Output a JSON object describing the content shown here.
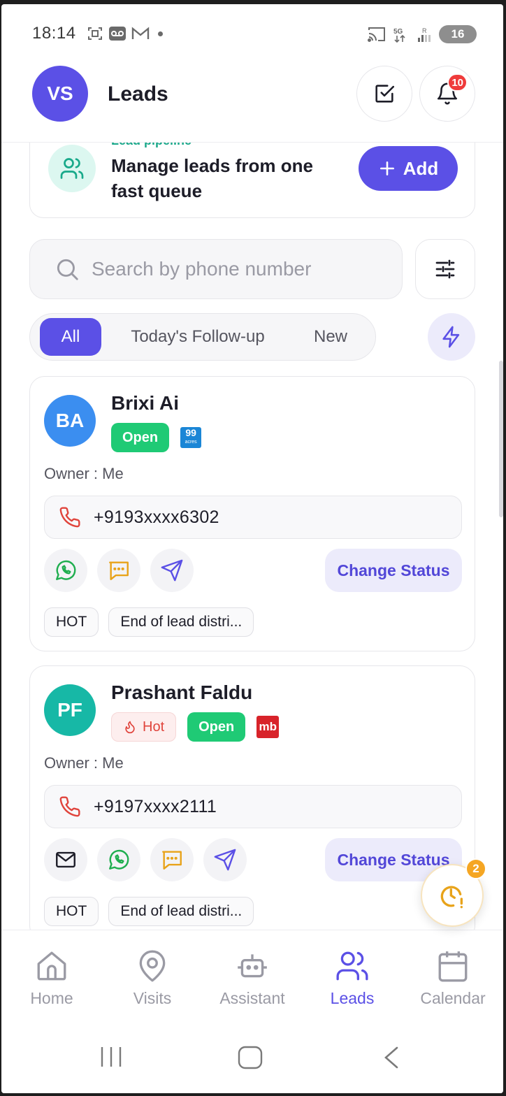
{
  "status_bar": {
    "time": "18:14",
    "battery": "16"
  },
  "header": {
    "avatar_initials": "VS",
    "title": "Leads",
    "notification_count": "10"
  },
  "pipeline": {
    "kicker": "Lead pipeline",
    "headline": "Manage leads from one fast queue",
    "add_label": "Add"
  },
  "search": {
    "placeholder": "Search by phone number",
    "value": ""
  },
  "tabs": [
    {
      "label": "All",
      "active": true
    },
    {
      "label": "Today's Follow-up",
      "active": false
    },
    {
      "label": "New",
      "active": false
    }
  ],
  "leads": [
    {
      "initials": "BA",
      "avatar_color": "#3b8ef0",
      "name": "Brixi Ai",
      "status": "Open",
      "source": "99acres",
      "source_label": "99",
      "source_sub": "acres",
      "owner": "Owner : Me",
      "phone": "+9193xxxx6302",
      "change_status_label": "Change Status",
      "tags": [
        "HOT",
        "End of lead distri..."
      ]
    },
    {
      "initials": "PF",
      "avatar_color": "#17b8a6",
      "name": "Prashant Faldu",
      "priority": "Hot",
      "status": "Open",
      "source": "magicbricks",
      "source_label": "mb",
      "owner": "Owner : Me",
      "phone": "+9197xxxx2111",
      "change_status_label": "Change Status",
      "tags": [
        "HOT",
        "End of lead distri..."
      ]
    }
  ],
  "fab": {
    "badge_count": "2"
  },
  "bottom_nav": [
    {
      "label": "Home",
      "icon": "home-icon",
      "active": false
    },
    {
      "label": "Visits",
      "icon": "map-pin-icon",
      "active": false
    },
    {
      "label": "Assistant",
      "icon": "robot-icon",
      "active": false
    },
    {
      "label": "Leads",
      "icon": "users-icon",
      "active": true
    },
    {
      "label": "Calendar",
      "icon": "calendar-icon",
      "active": false
    }
  ],
  "colors": {
    "accent": "#5b50e6",
    "open_green": "#1fca75",
    "hot_red": "#e0443c",
    "fab_orange": "#f5a623"
  }
}
